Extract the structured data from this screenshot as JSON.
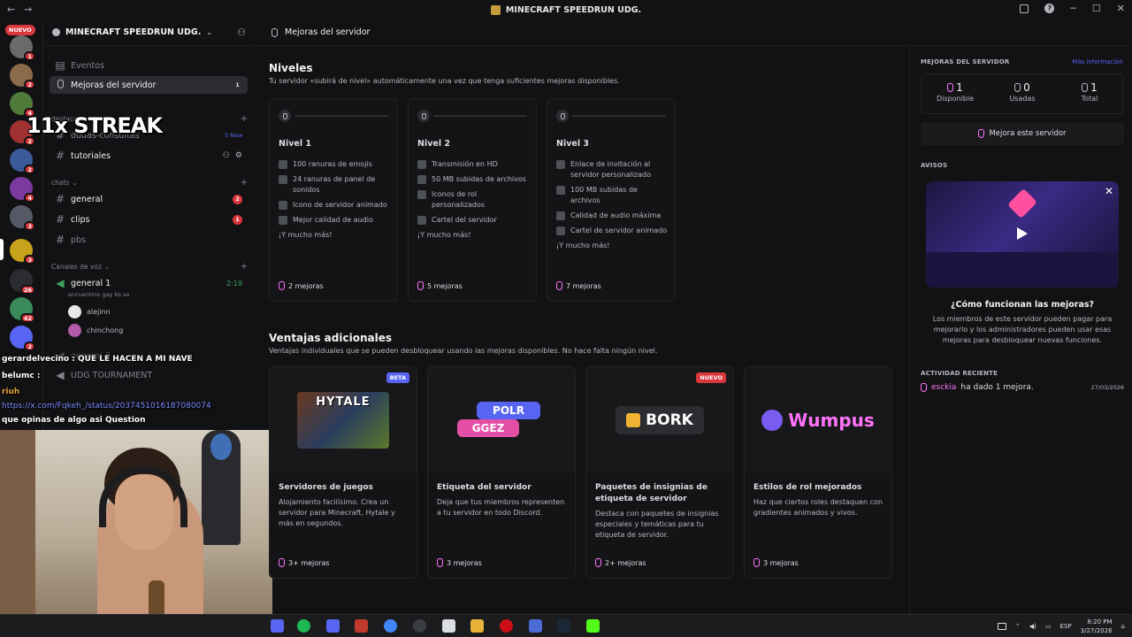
{
  "window": {
    "title": "MINECRAFT SPEEDRUN UDG."
  },
  "rail": {
    "new_label": "NUEVO",
    "servers": [
      {
        "badge": "1",
        "color": "#6a6a6a"
      },
      {
        "badge": "2",
        "color": "#8a6b4a"
      },
      {
        "badge": "4",
        "color": "#4f7c3a"
      },
      {
        "badge": "2",
        "color": "#a23232"
      },
      {
        "badge": "2",
        "color": "#3a5a9a"
      },
      {
        "badge": "4",
        "color": "#7a3aa0"
      },
      {
        "badge": "3",
        "color": "#555a66"
      },
      {
        "badge": "3",
        "color": "#c8a21a"
      },
      {
        "badge": "26",
        "color": "#2c2c30"
      },
      {
        "badge": "42",
        "color": "#3a8a5a"
      },
      {
        "badge": "2",
        "color": "#5865f2"
      }
    ]
  },
  "sidebar": {
    "server_name": "MINECRAFT SPEEDRUN UDG.",
    "events_label": "Eventos",
    "boosts_label": "Mejoras del servidor",
    "boosts_count": "1",
    "category_destacados": "destacados",
    "channel_dudas": "dudas-consultas",
    "new_tag": "5 New",
    "channel_tutoriales": "tutoriales",
    "category_chats": "chats",
    "channels": [
      {
        "name": "general",
        "count": "2"
      },
      {
        "name": "clips",
        "count": "1"
      },
      {
        "name": "pbs",
        "count": ""
      }
    ],
    "category_voice": "Canales de voz",
    "voice_channel": "general 1",
    "voice_time": "2:19",
    "voice_status": "encuentros gay bs as",
    "voice_users": [
      "alejinn",
      "chinchong"
    ],
    "voice_channel_2": "general 2",
    "voice_channel_3": "UDG TOURNAMENT"
  },
  "overlay": {
    "streak": "11x STREAK",
    "chat": [
      {
        "user": "gerardelvecino",
        "text": "QUE LE HACEN A MI NAVE"
      },
      {
        "user": "belumc",
        "text": ""
      },
      {
        "user": "riuh",
        "text": ""
      }
    ],
    "link": "https://x.com/Fqkeh_/status/2037451016187080074",
    "question": "que opinas de algo asi Question"
  },
  "main": {
    "header_title": "Mejoras del servidor",
    "levels_title": "Niveles",
    "levels_sub": "Tu servidor «subirá de nivel» automáticamente una vez que tenga suficientes mejoras disponibles.",
    "levels": [
      {
        "name": "Nivel 1",
        "perks": [
          "100 ranuras de emojis",
          "24 ranuras de panel de sonidos",
          "Icono de servidor animado",
          "Mejor calidad de audio"
        ],
        "more": "¡Y mucho más!",
        "boosts": "2 mejoras"
      },
      {
        "name": "Nivel 2",
        "perks": [
          "Transmisión en HD",
          "50 MB subidas de archivos",
          "Iconos de rol personalizados",
          "Cartel del servidor"
        ],
        "more": "¡Y mucho más!",
        "boosts": "5 mejoras"
      },
      {
        "name": "Nivel 3",
        "perks": [
          "Enlace de invitación al servidor personalizado",
          "100 MB subidas de archivos",
          "Calidad de audio máxima",
          "Cartel de servidor animado"
        ],
        "more": "¡Y mucho más!",
        "boosts": "7 mejoras"
      }
    ],
    "perks_title": "Ventajas adicionales",
    "perks_sub": "Ventajas individuales que se pueden desbloquear usando las mejoras disponibles. No hace falta ningún nivel.",
    "perks": [
      {
        "tag": "BETA",
        "tag_color": "#5865f2",
        "art": "HYTALE",
        "title": "Servidores de juegos",
        "desc": "Alojamiento facilísimo. Crea un servidor para Minecraft, Hytale y más en segundos.",
        "boosts": "3+ mejoras"
      },
      {
        "tag": "",
        "tag_color": "",
        "art": "POLR / GGEZ",
        "title": "Etiqueta del servidor",
        "desc": "Deja que tus miembros representen a tu servidor en todo Discord.",
        "boosts": "3 mejoras"
      },
      {
        "tag": "NUEVO",
        "tag_color": "#da373c",
        "art": "BORK",
        "title": "Paquetes de insignias de etiqueta de servidor",
        "desc": "Destaca con paquetes de insignias especiales y temáticas para tu etiqueta de servidor.",
        "boosts": "2+ mejoras"
      },
      {
        "tag": "",
        "tag_color": "",
        "art": "Wumpus",
        "title": "Estilos de rol mejorados",
        "desc": "Haz que ciertos roles destaquen con gradientes animados y vivos.",
        "boosts": "3 mejoras"
      }
    ]
  },
  "right": {
    "boosts_header": "MEJORAS DEL SERVIDOR",
    "more_info": "Más información",
    "stats": [
      {
        "value": "1",
        "label": "Disponible"
      },
      {
        "value": "0",
        "label": "Usadas"
      },
      {
        "value": "1",
        "label": "Total"
      }
    ],
    "boost_button": "Mejora este servidor",
    "notices_header": "AVISOS",
    "video_title": "¿Cómo funcionan las mejoras?",
    "video_desc": "Los miembros de este servidor pueden pagar para mejorarlo y los administradores pueden usar esas mejoras para desbloquear nuevas funciones.",
    "activity_header": "ACTIVIDAD RECIENTE",
    "activity_user": "esckia",
    "activity_text": "ha dado 1 mejora.",
    "activity_date": "27/03/2026"
  },
  "taskbar": {
    "lang": "ESP",
    "time": "8:20 PM",
    "date": "3/27/2026"
  }
}
